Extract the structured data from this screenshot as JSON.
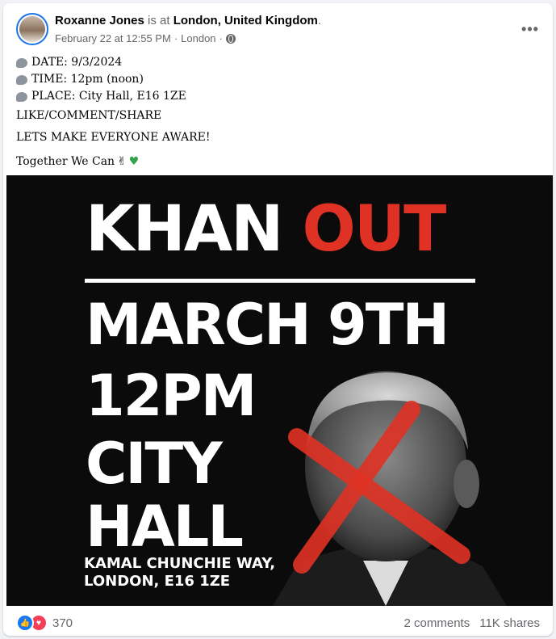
{
  "post": {
    "author": "Roxanne Jones",
    "is_at": "is at",
    "place": "London, United Kingdom",
    "period": ".",
    "date": "February 22 at 12:55 PM",
    "separator": "·",
    "location": "London",
    "separator2": "·",
    "privacy_icon": "globe-icon",
    "more_icon": "more-options-icon",
    "more_glyph": "•••"
  },
  "body": {
    "date_line": "DATE: 9/3/2024",
    "time_line": "TIME: 12pm (noon)",
    "place_line": "PLACE: City Hall, E16 1ZE",
    "share_line": "LIKE/COMMENT/SHARE",
    "aware_line": "LETS MAKE EVERYONE AWARE!",
    "together_line": "Together We Can",
    "emoji_peace": "✌",
    "emoji_heart": "♥"
  },
  "poster": {
    "word_khan": "KHAN",
    "word_out": "OUT",
    "date": "MARCH 9TH",
    "time": "12PM",
    "city": "CITY",
    "hall": "HALL",
    "address_line1": "KAMAL CHUNCHIE WAY,",
    "address_line2": "LONDON, E16 1ZE"
  },
  "footer": {
    "like_glyph": "👍",
    "love_glyph": "♥",
    "reaction_count": "370",
    "comments": "2 comments",
    "shares": "11K shares"
  },
  "colors": {
    "accent": "#1877f2",
    "poster_red": "#e03224",
    "poster_bg": "#0b0b0b",
    "heart_green": "#31a24c"
  }
}
